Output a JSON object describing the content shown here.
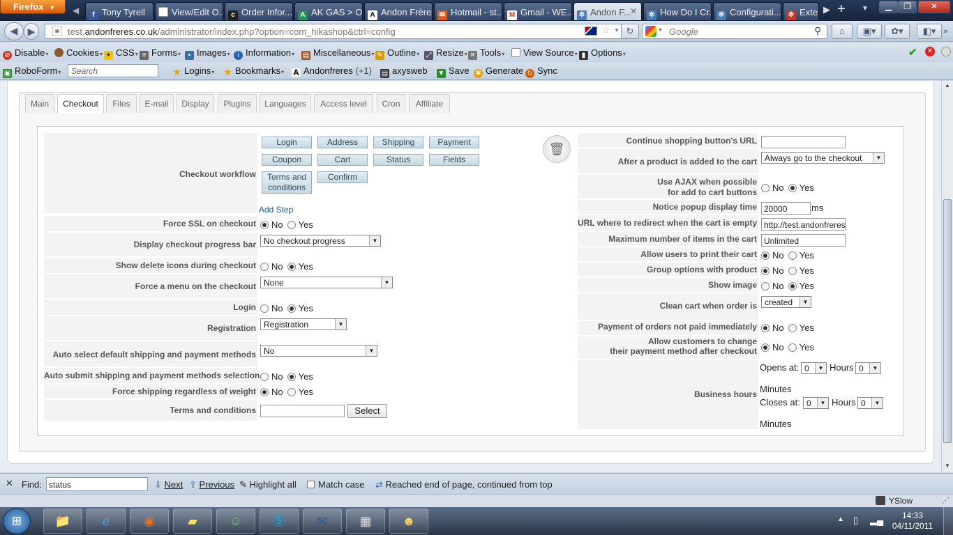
{
  "browser": {
    "app_button": "Firefox",
    "tabs": [
      {
        "label": "Tony Tyrell",
        "icon": "facebook-icon",
        "color": "#3b5998"
      },
      {
        "label": "View/Edit O...",
        "icon": "page-icon",
        "color": "#ffffff"
      },
      {
        "label": "Order Infor...",
        "icon": "cs-icon",
        "color": "#222222"
      },
      {
        "label": "AK GAS > O...",
        "icon": "ak-icon",
        "color": "#2e8b57"
      },
      {
        "label": "Andon Frères",
        "icon": "andon-icon",
        "color": "#111111"
      },
      {
        "label": "Hotmail - st...",
        "icon": "hotmail-icon",
        "color": "#e55b13"
      },
      {
        "label": "Gmail - WE...",
        "icon": "gmail-icon",
        "color": "#d93025"
      },
      {
        "label": "Andon F...",
        "icon": "joomla-icon",
        "color": "#4a7db5",
        "selected": true
      },
      {
        "label": "How Do I Cr...",
        "icon": "joomla-icon",
        "color": "#4a7db5"
      },
      {
        "label": "Configurati...",
        "icon": "joomla-icon",
        "color": "#4a7db5"
      },
      {
        "label": "Exten",
        "icon": "joomla-icon",
        "color": "#c0392b"
      }
    ],
    "url_prefix": "test.",
    "url_domain": "andonfreres.co.uk",
    "url_path": "/administrator/index.php?option=com_hikashop&ctrl=config",
    "search_placeholder": "Google"
  },
  "webdev_toolbar": [
    "Disable",
    "Cookies",
    "CSS",
    "Forms",
    "Images",
    "Information",
    "Miscellaneous",
    "Outline",
    "Resize",
    "Tools",
    "View Source",
    "Options"
  ],
  "roboform": {
    "label": "RoboForm",
    "search_placeholder": "Search",
    "logins": "Logins",
    "bookmarks": "Bookmarks",
    "andonfreres": "Andonfreres",
    "plus": "(+1)",
    "axysweb": "axysweb",
    "save": "Save",
    "generate": "Generate",
    "sync": "Sync"
  },
  "config_tabs": [
    "Main",
    "Checkout",
    "Files",
    "E-mail",
    "Display",
    "Plugins",
    "Languages",
    "Access level",
    "Cron",
    "Affiliate"
  ],
  "left": {
    "checkout_workflow": {
      "label": "Checkout workflow",
      "steps": [
        "Login",
        "Address",
        "Shipping",
        "Payment",
        "Coupon",
        "Cart",
        "Status",
        "Fields",
        "Terms and conditions",
        "Confirm"
      ],
      "add_step": "Add Step"
    },
    "force_ssl": {
      "label": "Force SSL on checkout",
      "value": "No"
    },
    "progress_bar": {
      "label": "Display checkout progress bar",
      "value": "No checkout progress"
    },
    "delete_icons": {
      "label": "Show delete icons during checkout",
      "value": "Yes"
    },
    "force_menu": {
      "label": "Force a menu on the checkout",
      "value": "None"
    },
    "login": {
      "label": "Login",
      "value": "Yes"
    },
    "registration": {
      "label": "Registration",
      "value": "Registration"
    },
    "auto_select": {
      "label": "Auto select default shipping and payment methods",
      "value": "No"
    },
    "auto_submit": {
      "label": "Auto submit shipping and payment methods selection",
      "value": "Yes"
    },
    "force_shipping": {
      "label": "Force shipping regardless of weight",
      "value": "No"
    },
    "terms": {
      "label": "Terms and conditions",
      "value": "",
      "button": "Select"
    }
  },
  "right": {
    "continue_url": {
      "label": "Continue shopping button's URL",
      "value": ""
    },
    "after_add": {
      "label": "After a product is added to the cart",
      "value": "Always go to the checkout"
    },
    "ajax_line1": "Use AJAX when possible",
    "ajax_line2": "for add to cart buttons",
    "ajax_value": "Yes",
    "popup": {
      "label": "Notice popup display time",
      "value": "20000",
      "unit": "ms"
    },
    "redirect": {
      "label": "URL where to redirect when the cart is empty",
      "value": "http://test.andonfreres.co"
    },
    "max_items": {
      "label": "Maximum number of items in the cart",
      "value": "Unlimited"
    },
    "print_cart": {
      "label": "Allow users to print their cart",
      "value": "No"
    },
    "group_options": {
      "label": "Group options with product",
      "value": "No"
    },
    "show_image": {
      "label": "Show image",
      "value": "Yes"
    },
    "clean_cart": {
      "label": "Clean cart when order is",
      "value": "created"
    },
    "payment_unpaid": {
      "label": "Payment of orders not paid immediately",
      "value": "No"
    },
    "change_line1": "Allow customers to change",
    "change_line2": "their payment method after checkout",
    "change_value": "No",
    "business_hours": {
      "label": "Business hours",
      "opens_at": "Opens at:",
      "closes_at": "Closes at:",
      "hours": "Hours",
      "minutes": "Minutes",
      "open_hour": "0",
      "open_min": "0",
      "close_hour": "0",
      "close_min": "0"
    }
  },
  "radio_labels": {
    "no": "No",
    "yes": "Yes"
  },
  "findbar": {
    "label": "Find:",
    "value": "status",
    "next": "Next",
    "previous": "Previous",
    "highlight": "Highlight all",
    "match_case": "Match case",
    "message": "Reached end of page, continued from top"
  },
  "statusbar": {
    "yslow": "YSlow"
  },
  "taskbar": {
    "time": "14:33",
    "date": "04/11/2011"
  }
}
